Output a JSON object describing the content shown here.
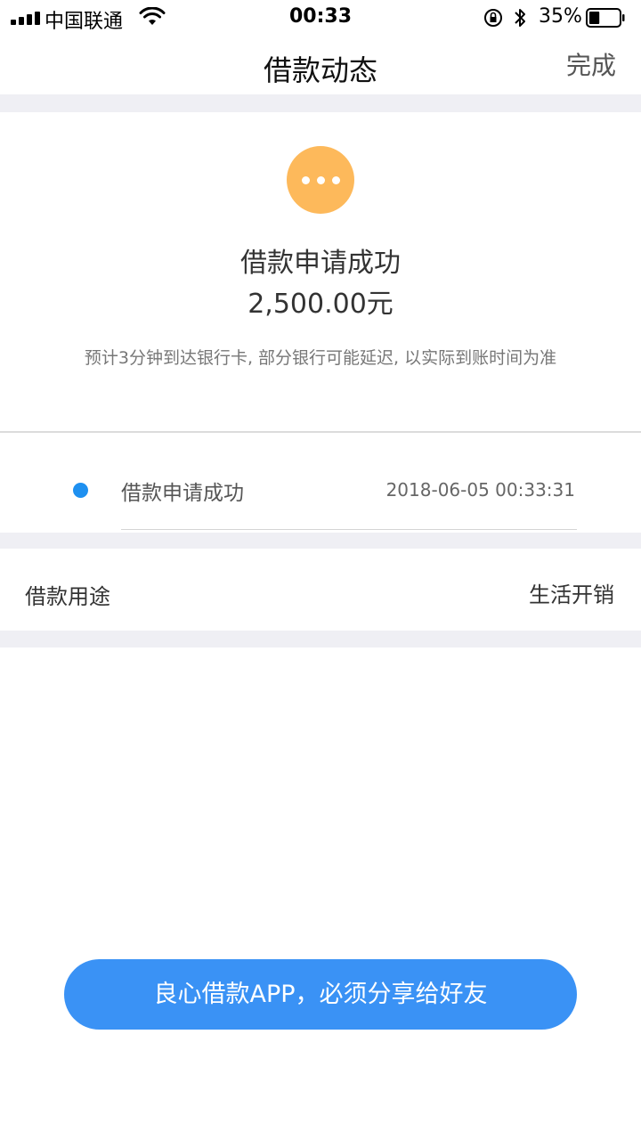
{
  "status_bar": {
    "carrier": "中国联通",
    "time": "00:33",
    "battery_percent": "35%",
    "battery_level": 0.35
  },
  "nav": {
    "title": "借款动态",
    "done_label": "完成"
  },
  "loan_status": {
    "icon": "pending-dots-icon",
    "title": "借款申请成功",
    "amount": "2,500.00元",
    "note": "预计3分钟到达银行卡, 部分银行可能延迟, 以实际到账时间为准"
  },
  "timeline": [
    {
      "label": "借款申请成功",
      "time": "2018-06-05 00:33:31"
    }
  ],
  "purpose": {
    "label": "借款用途",
    "value": "生活开销"
  },
  "share_button": {
    "label": "良心借款APP，必须分享给好友"
  },
  "colors": {
    "accent_blue": "#3a92f5",
    "timeline_dot": "#1e90f0",
    "pending_orange": "#fdb95b",
    "band_gray": "#efeff4"
  }
}
